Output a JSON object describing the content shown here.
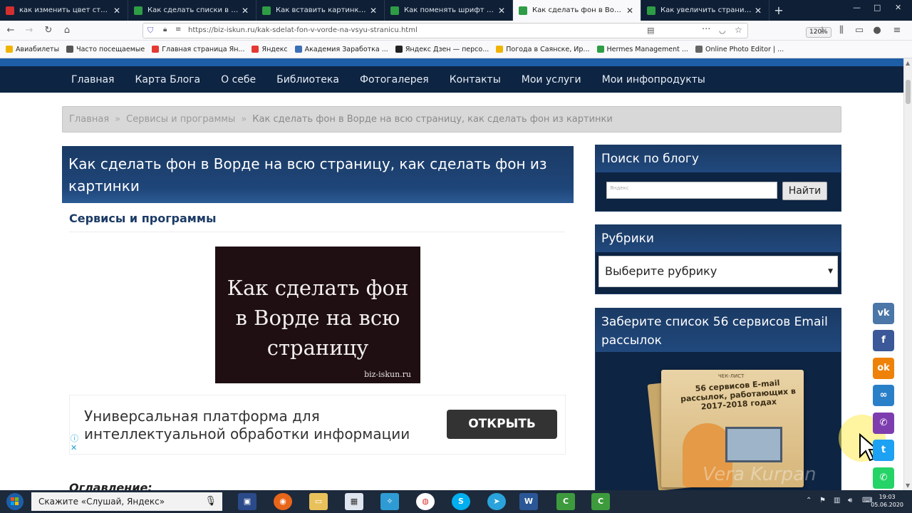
{
  "browser": {
    "tabs": [
      {
        "title": "как изменить цвет страницы ...",
        "favicon_color": "#d32f2f",
        "active": false
      },
      {
        "title": "Как сделать списки в Ворде (",
        "favicon_color": "#2e9d46",
        "active": false
      },
      {
        "title": "Как вставить картинку в Ворд",
        "favicon_color": "#2e9d46",
        "active": false
      },
      {
        "title": "Как поменять шрифт в Ворде",
        "favicon_color": "#2e9d46",
        "active": false
      },
      {
        "title": "Как сделать фон в Ворде на в",
        "favicon_color": "#2e9d46",
        "active": true
      },
      {
        "title": "Как увеличить страницу в Вор",
        "favicon_color": "#2e9d46",
        "active": false
      }
    ],
    "new_tab_icon": "+",
    "url": "https://biz-iskun.ru/kak-sdelat-fon-v-vorde-na-vsyu-stranicu.html",
    "zoom": "120%",
    "bookmarks": [
      {
        "label": "Авиабилеты",
        "color": "#f0b400"
      },
      {
        "label": "Часто посещаемые",
        "color": "#555555"
      },
      {
        "label": "Главная страница Ян...",
        "color": "#e53935"
      },
      {
        "label": "Яндекс",
        "color": "#e53935"
      },
      {
        "label": "Академия Заработка ...",
        "color": "#3d6fb6"
      },
      {
        "label": "Яндекс Дзен — персо...",
        "color": "#222222"
      },
      {
        "label": "Погода в Саянске, Ир...",
        "color": "#f0b400"
      },
      {
        "label": "Hermes Management ...",
        "color": "#2e9d46"
      },
      {
        "label": "Online Photo Editor | ...",
        "color": "#666666"
      }
    ]
  },
  "site": {
    "nav": [
      "Главная",
      "Карта Блога",
      "О себе",
      "Библиотека",
      "Фотогалерея",
      "Контакты",
      "Мои услуги",
      "Мои инфопродукты"
    ],
    "breadcrumb": [
      "Главная",
      "Сервисы и программы",
      "Как сделать фон в Ворде на всю страницу, как сделать фон из картинки"
    ],
    "breadcrumb_sep": "»",
    "article_title": "Как сделать фон в Ворде на всю страницу, как сделать фон из картинки",
    "category": "Сервисы и программы",
    "thumbnail": {
      "text": "Как сделать фон в Ворде на всю страницу",
      "source": "biz-iskun.ru"
    },
    "ad": {
      "text": "Универсальная платформа для интеллектуальной обработки информации",
      "button": "ОТКРЫТЬ",
      "info_icon": "ⓘ",
      "close_icon": "✕"
    },
    "toc_heading": "Оглавление:"
  },
  "sidebar": {
    "search": {
      "title": "Поиск по блогу",
      "placeholder": "Яндекс",
      "button": "Найти"
    },
    "rubrics": {
      "title": "Рубрики",
      "select_value": "Выберите рубрику"
    },
    "email": {
      "title": "Заберите список 56 сервисов Email рассылок",
      "book_label": "ЧЕК-ЛИСТ",
      "book_text": "56 сервисов E-mail рассылок, работающих в 2017-2018 годах",
      "watermark": "Vera Kurpan"
    }
  },
  "social": [
    {
      "name": "vk-icon",
      "label": "vk",
      "color": "#4a76a8"
    },
    {
      "name": "facebook-icon",
      "label": "f",
      "color": "#3b5998"
    },
    {
      "name": "odnoklassniki-icon",
      "label": "ok",
      "color": "#ee8208"
    },
    {
      "name": "link-icon",
      "label": "∞",
      "color": "#2a7fc9"
    },
    {
      "name": "viber-icon",
      "label": "✆",
      "color": "#7d3daf"
    },
    {
      "name": "twitter-icon",
      "label": "t",
      "color": "#1da1f2"
    },
    {
      "name": "whatsapp-icon",
      "label": "✆",
      "color": "#25d366"
    }
  ],
  "taskbar": {
    "search_text": "Скажите «Слушай, Яндекс»",
    "time": "19:03",
    "date": "05.06.2020"
  }
}
